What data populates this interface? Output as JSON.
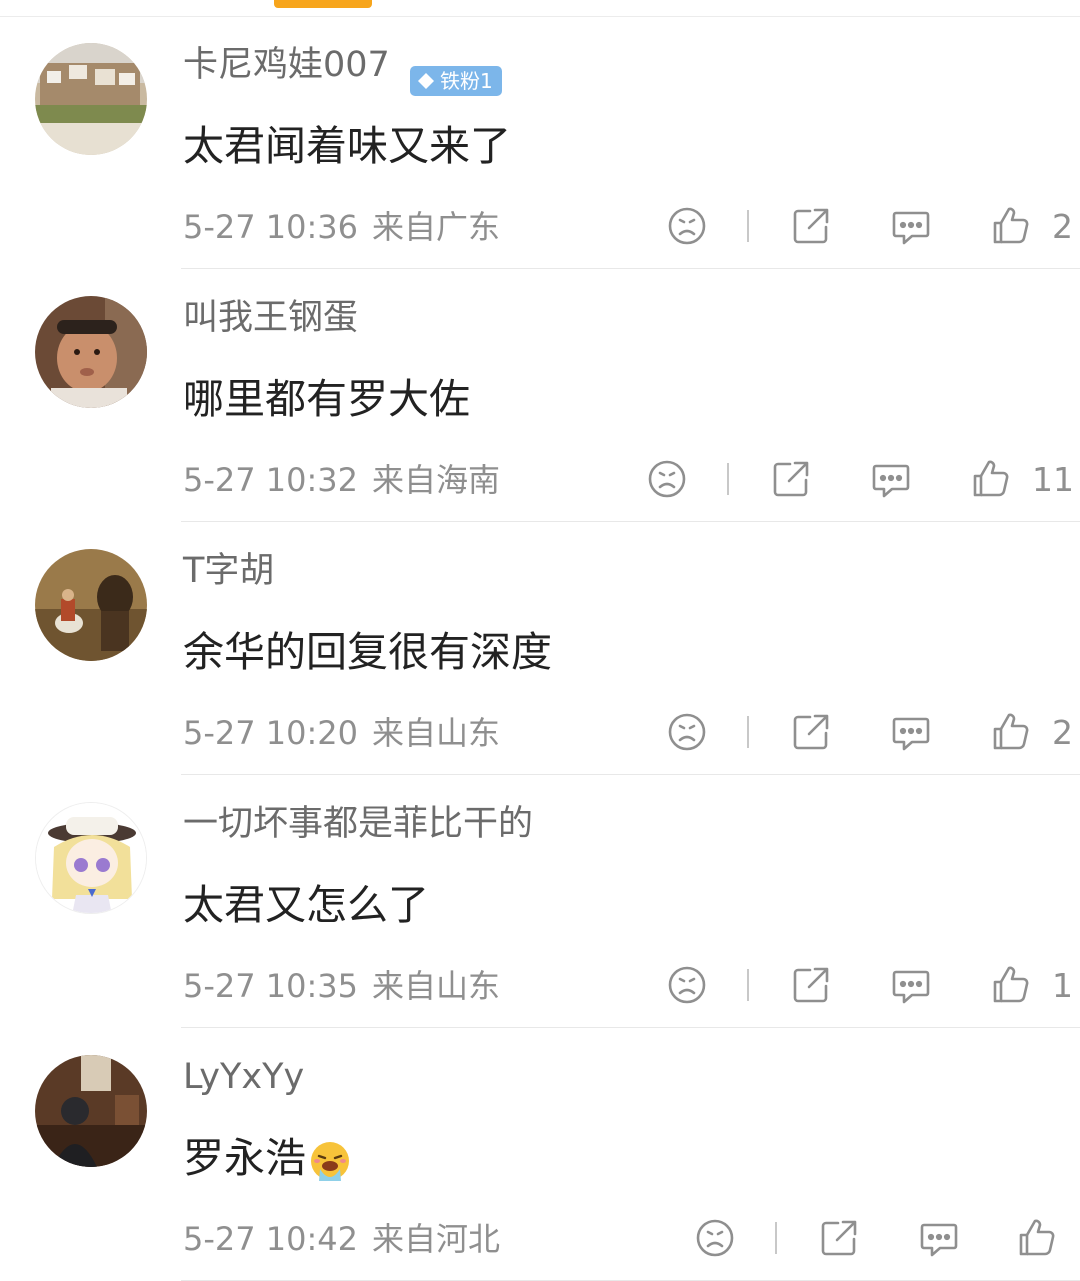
{
  "colors": {
    "accent": "#f7a51c",
    "badge": "#7cb6ea",
    "text_main": "#222222",
    "text_muted": "#8f8f8f"
  },
  "comments": [
    {
      "username": "卡尼鸡娃007",
      "badge": "铁粉1",
      "text": "太君闻着味又来了",
      "time": "5-27 10:36",
      "location": "来自广东",
      "likes": "2",
      "avatar_icon": "landscape-avatar"
    },
    {
      "username": "叫我王钢蛋",
      "text": "哪里都有罗大佐",
      "time": "5-27 10:32",
      "location": "来自海南",
      "likes": "11",
      "avatar_icon": "child-avatar"
    },
    {
      "username": "T字胡",
      "text": "余华的回复很有深度",
      "time": "5-27 10:20",
      "location": "来自山东",
      "likes": "2",
      "avatar_icon": "painting-avatar"
    },
    {
      "username": "一切坏事都是菲比干的",
      "text": "太君又怎么了",
      "time": "5-27 10:35",
      "location": "来自山东",
      "likes": "1",
      "avatar_icon": "anime-girl-avatar"
    },
    {
      "username": "LyYxYy",
      "text": "罗永浩",
      "text_emoji": "vomit-emoji",
      "time": "5-27 10:42",
      "location": "来自河北",
      "likes": "",
      "avatar_icon": "cafe-avatar"
    }
  ],
  "icons": {
    "dislike": "sad-face-icon",
    "share": "share-icon",
    "reply": "comment-icon",
    "like": "thumbs-up-icon"
  }
}
